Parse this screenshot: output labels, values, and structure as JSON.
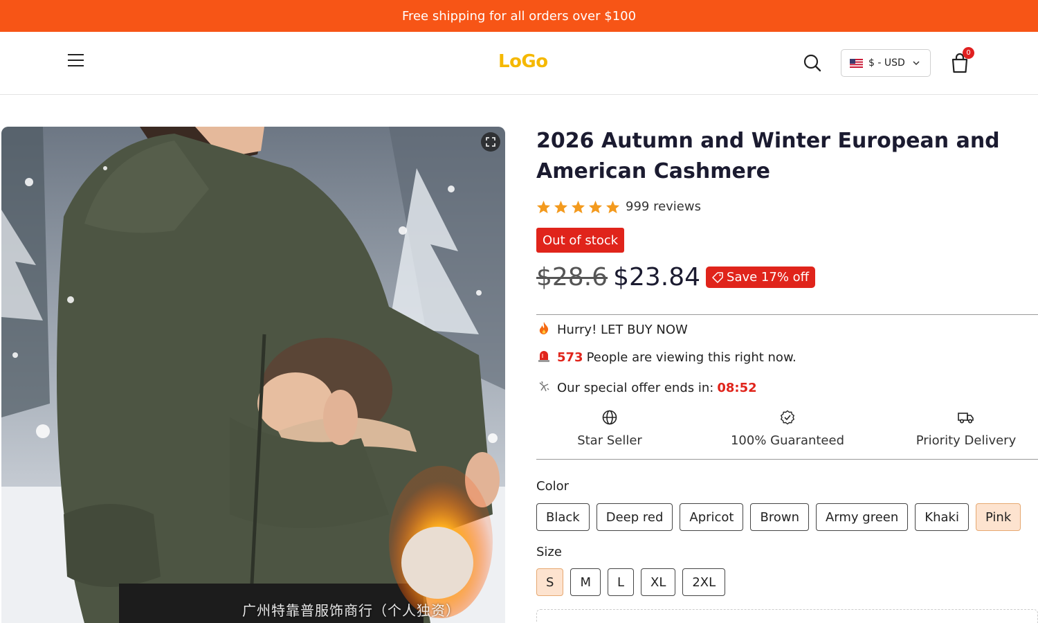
{
  "announcement": "Free shipping for all orders over $100",
  "header": {
    "logo": "LoGo",
    "currency": "$ - USD",
    "cart_count": "0"
  },
  "gallery": {
    "watermark": "广州特靠普服饰商行（个人独资）"
  },
  "product": {
    "title": "2026 Autumn and Winter European and American Cashmere",
    "rating": 5,
    "reviews": "999 reviews",
    "stock_status": "Out of stock",
    "old_price": "$28.6",
    "price": "$23.84",
    "save": "Save 17% off"
  },
  "urgency": {
    "hurry": "Hurry! LET BUY NOW",
    "viewers_count": "573",
    "viewers_text": "People are viewing this right now.",
    "offer_text": "Our special offer ends in:",
    "timer": "08:52"
  },
  "badges": [
    {
      "label": "Star Seller",
      "icon": "globe-icon"
    },
    {
      "label": "100% Guaranteed",
      "icon": "check-badge-icon"
    },
    {
      "label": "Priority Delivery",
      "icon": "truck-icon"
    }
  ],
  "options": {
    "color_label": "Color",
    "colors": [
      "Black",
      "Deep red",
      "Apricot",
      "Brown",
      "Army green",
      "Khaki",
      "Pink"
    ],
    "selected_color": "Pink",
    "size_label": "Size",
    "sizes": [
      "S",
      "M",
      "L",
      "XL",
      "2XL"
    ],
    "selected_size": "S"
  },
  "colors": {
    "accent": "#f75516",
    "logo": "#f5b800",
    "sale_red": "#e0241b",
    "star": "#f39a1e",
    "selected_swatch": "#fde3cf"
  }
}
